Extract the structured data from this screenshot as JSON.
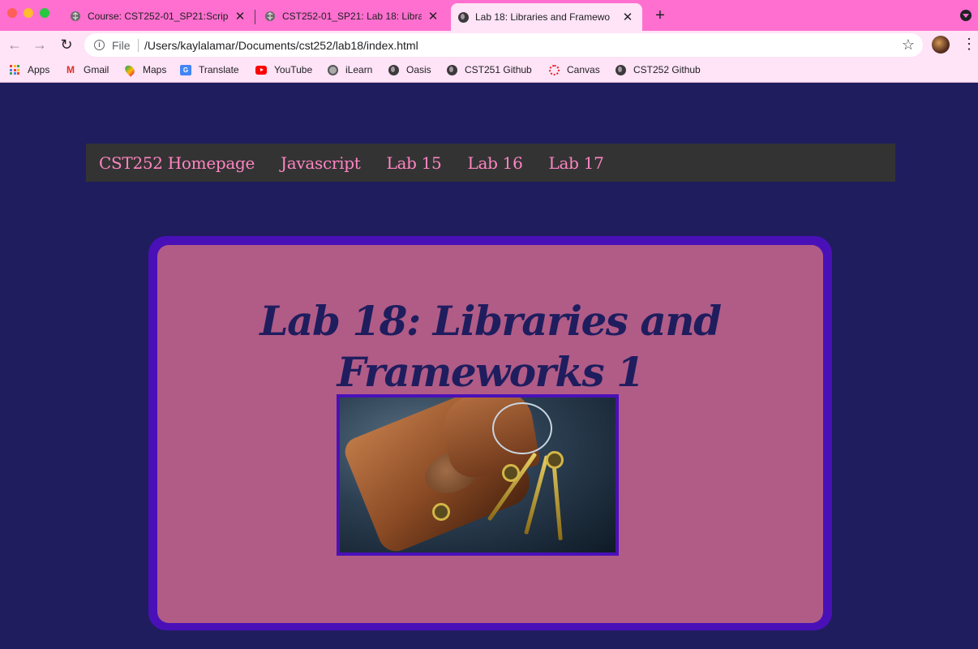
{
  "browser": {
    "tabs": [
      {
        "title": "Course: CST252-01_SP21:Scrip",
        "icon": "brain-icon",
        "active": false
      },
      {
        "title": "CST252-01_SP21: Lab 18: Libra",
        "icon": "brain-icon",
        "active": false
      },
      {
        "title": "Lab 18: Libraries and Framewo",
        "icon": "globe-icon",
        "active": true
      }
    ],
    "new_tab": "+",
    "address": {
      "scheme_label": "File",
      "url": "/Users/kaylalamar/Documents/cst252/lab18/index.html"
    },
    "bookmarks": [
      {
        "label": "Apps",
        "icon": "apps-grid-icon"
      },
      {
        "label": "Gmail",
        "icon": "gmail-icon"
      },
      {
        "label": "Maps",
        "icon": "maps-pin-icon"
      },
      {
        "label": "Translate",
        "icon": "translate-icon"
      },
      {
        "label": "YouTube",
        "icon": "youtube-icon"
      },
      {
        "label": "iLearn",
        "icon": "ilearn-icon"
      },
      {
        "label": "Oasis",
        "icon": "globe-icon"
      },
      {
        "label": "CST251 Github",
        "icon": "globe-icon"
      },
      {
        "label": "Canvas",
        "icon": "canvas-icon"
      },
      {
        "label": "CST252 Github",
        "icon": "globe-icon"
      }
    ],
    "colors": {
      "tabstrip": "#ff6fcf",
      "toolbar": "#ffe3f7"
    }
  },
  "site": {
    "nav": [
      {
        "label": "CST252 Homepage"
      },
      {
        "label": "Javascript"
      },
      {
        "label": "Lab 15"
      },
      {
        "label": "Lab 16"
      },
      {
        "label": "Lab 17"
      }
    ],
    "heading_line1": "Lab 18: Libraries and",
    "heading_line2": "Frameworks 1",
    "image_alt": "Leather key pouch with golden keys",
    "colors": {
      "page_background": "#1f1d5e",
      "nav_background": "#333333",
      "nav_link": "#ff85c2",
      "card_border": "#4a10b8",
      "card_background": "#b05c86",
      "heading": "#1f1d5e"
    }
  }
}
